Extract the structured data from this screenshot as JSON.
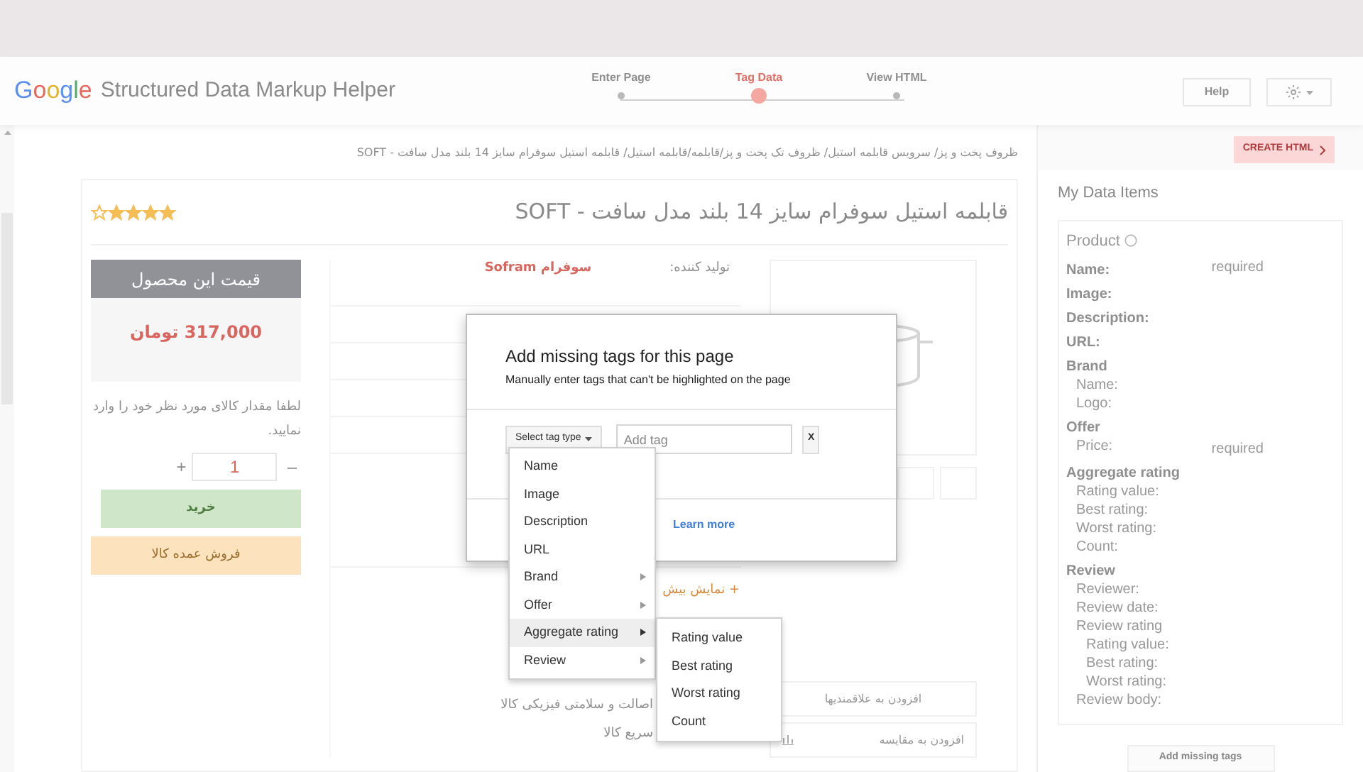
{
  "header": {
    "logo": "Google",
    "title": "Structured Data Markup Helper",
    "steps": [
      {
        "label": "Enter Page",
        "selected": false
      },
      {
        "label": "Tag Data",
        "selected": true
      },
      {
        "label": "View HTML",
        "selected": false
      }
    ],
    "help": "Help"
  },
  "page": {
    "breadcrumb": "ظروف پخت و پز/ سرویس قابلمه استیل/ ظروف تک پخت و پز/قابلمه/قابلمه استیل/ قابلمه استیل سوفرام سایز 14 بلند مدل سافت - SOFT",
    "title": "قابلمه استیل سوفرام سایز 14 بلند مدل سافت - SOFT",
    "stars": 4,
    "price_header": "قیمت این محصول",
    "price": "317,000 تومان",
    "quantity_hint": "لطفا مقدار کالای مورد نظر خود را وارد نمایید.",
    "plus": "+",
    "quantity": "1",
    "minus": "–",
    "buy": "خرید",
    "wholesale": "فروش عمده کالا",
    "maker_label": "تولید کننده:",
    "maker": "سوفرام Sofram",
    "show_more": "+ نمایش بیش",
    "features": [
      "اصالت و سلامتی فیزیکی کالا",
      "سریع کالا"
    ],
    "wishlist": "افزودن به علاقمندیها",
    "compare": "افزودن به مقایسه"
  },
  "dialog": {
    "title": "Add missing tags for this page",
    "subtitle": "Manually enter tags that can't be highlighted on the page",
    "select_label": "Select tag type",
    "tag_placeholder": "Add tag",
    "close": "X",
    "learn_more": "Learn more",
    "menu": [
      {
        "label": "Name",
        "submenu": false,
        "selected": false
      },
      {
        "label": "Image",
        "submenu": false,
        "selected": false
      },
      {
        "label": "Description",
        "submenu": false,
        "selected": false
      },
      {
        "label": "URL",
        "submenu": false,
        "selected": false
      },
      {
        "label": "Brand",
        "submenu": true,
        "selected": false
      },
      {
        "label": "Offer",
        "submenu": true,
        "selected": false
      },
      {
        "label": "Aggregate rating",
        "submenu": true,
        "selected": true
      },
      {
        "label": "Review",
        "submenu": true,
        "selected": false
      }
    ],
    "submenu": [
      "Rating value",
      "Best rating",
      "Worst rating",
      "Count"
    ]
  },
  "sidebar": {
    "create_button": "CREATE HTML",
    "heading": "My Data Items",
    "card_title": "Product",
    "items": [
      {
        "label": "Name:",
        "note": "required"
      },
      {
        "label": "Image:"
      },
      {
        "label": "Description:"
      },
      {
        "label": "URL:"
      },
      {
        "label": "Brand",
        "children": [
          {
            "label": "Name:"
          },
          {
            "label": "Logo:"
          }
        ]
      },
      {
        "label": "Offer",
        "children": [
          {
            "label": "Price:",
            "note": "required"
          }
        ]
      },
      {
        "label": "Aggregate rating",
        "children": [
          {
            "label": "Rating value:"
          },
          {
            "label": "Best rating:"
          },
          {
            "label": "Worst rating:"
          },
          {
            "label": "Count:"
          }
        ]
      },
      {
        "label": "Review",
        "children": [
          {
            "label": "Reviewer:"
          },
          {
            "label": "Review date:"
          },
          {
            "label": "Review rating",
            "children": [
              {
                "label": "Rating value:"
              },
              {
                "label": "Best rating:"
              },
              {
                "label": "Worst rating:"
              }
            ]
          },
          {
            "label": "Review body:"
          }
        ]
      }
    ],
    "add_missing": "Add missing tags"
  }
}
